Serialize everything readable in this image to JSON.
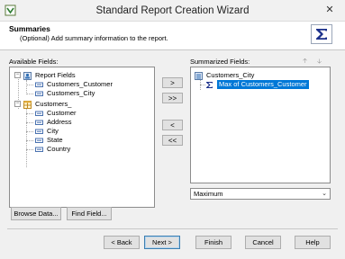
{
  "window": {
    "title": "Standard Report Creation Wizard"
  },
  "header": {
    "title": "Summaries",
    "subtitle": "(Optional) Add summary information to the report."
  },
  "available": {
    "label": "Available Fields:",
    "groups": [
      {
        "label": "Report Fields",
        "items": [
          "Customers_Customer",
          "Customers_City"
        ]
      },
      {
        "label": "Customers_",
        "items": [
          "Customer",
          "Address",
          "City",
          "State",
          "Country"
        ]
      }
    ]
  },
  "summarized": {
    "label": "Summarized Fields:",
    "group": "Customers_City",
    "item": "Max of Customers_Customer"
  },
  "transfer": {
    "add": ">",
    "add_all": ">>",
    "remove": "<",
    "remove_all": "<<"
  },
  "summary_type": {
    "selected": "Maximum"
  },
  "buttons": {
    "browse": "Browse Data...",
    "find": "Find Field...",
    "back": "< Back",
    "next": "Next >",
    "finish": "Finish",
    "cancel": "Cancel",
    "help": "Help"
  },
  "colors": {
    "accent": "#0078d7",
    "sigma": "#1a2f8a"
  }
}
